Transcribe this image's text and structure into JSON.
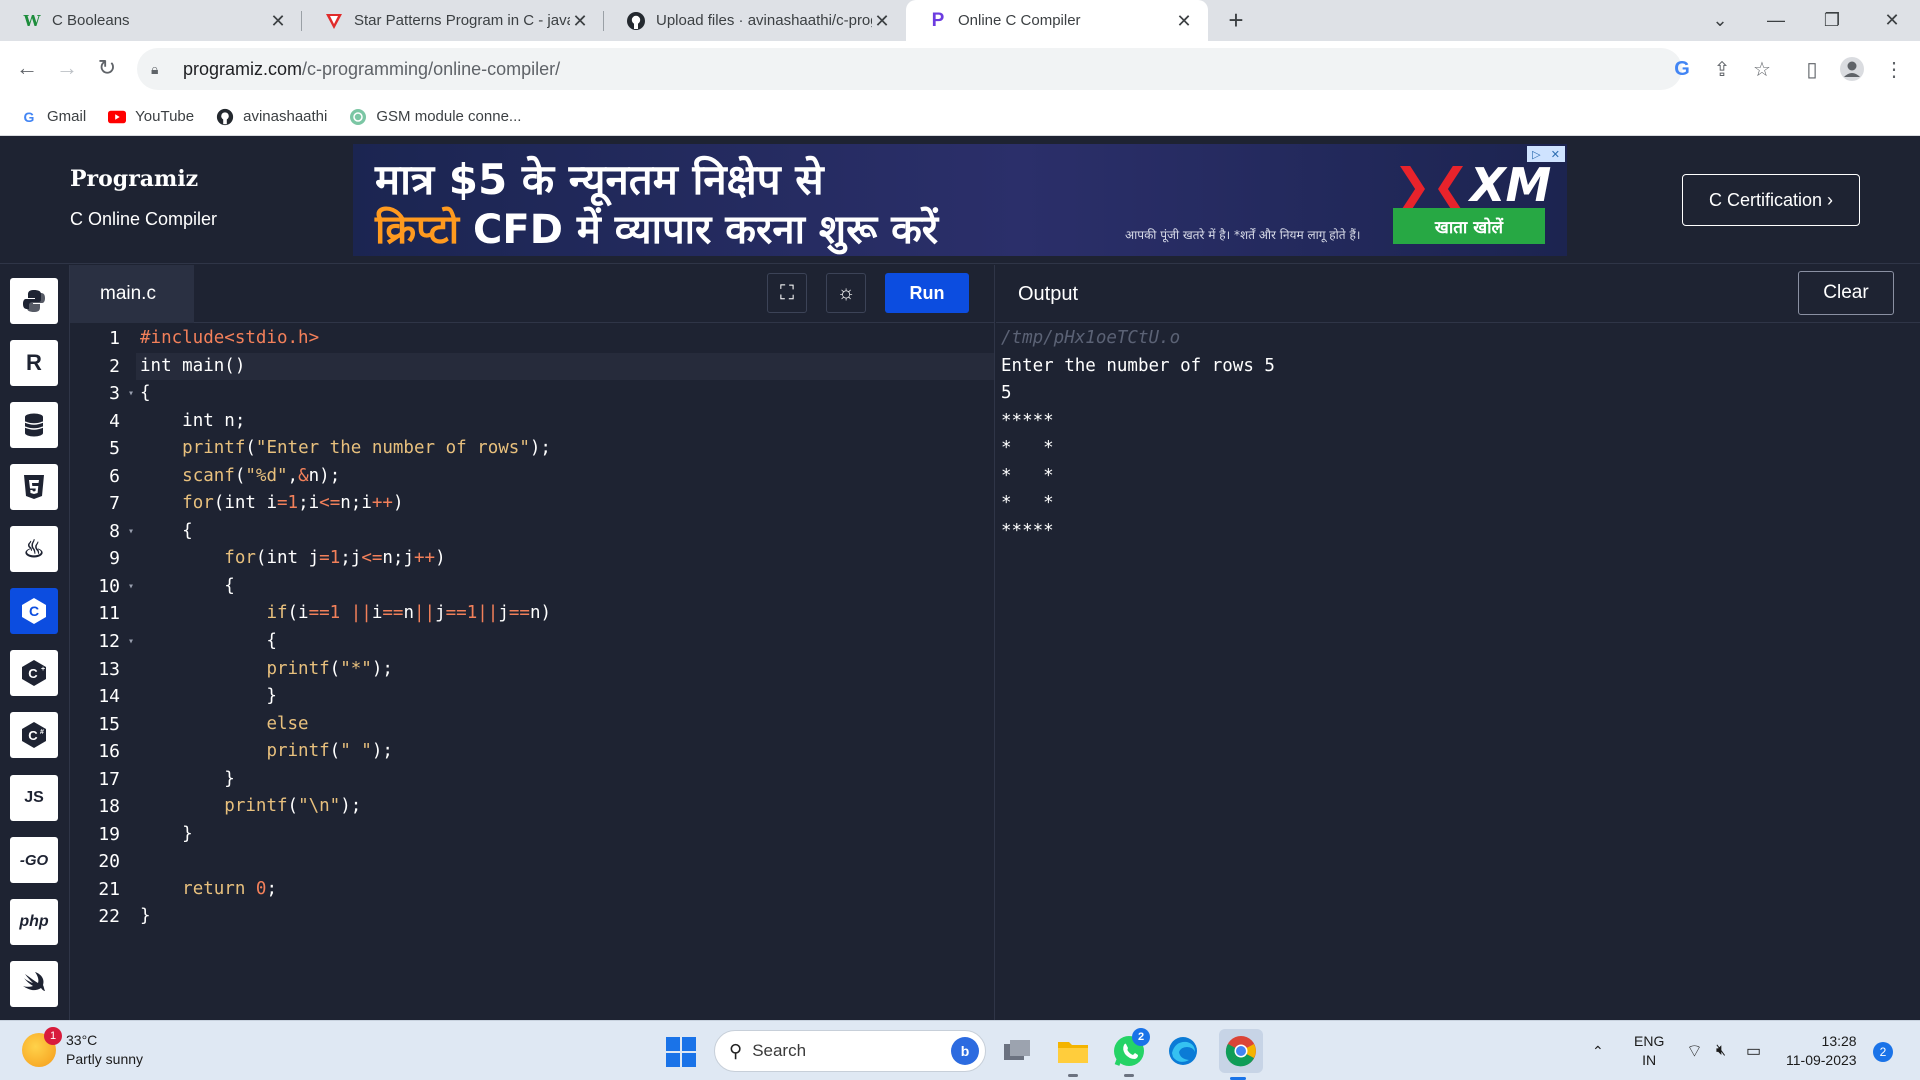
{
  "browser": {
    "tabs": [
      {
        "title": "C Booleans",
        "icon": "w-icon",
        "icon_color": "#1d8d3c"
      },
      {
        "title": "Star Patterns Program in C - javat",
        "icon": "javatpoint-icon",
        "icon_color": "#e02b2b"
      },
      {
        "title": "Upload files · avinashaathi/c-prog",
        "icon": "github-icon",
        "icon_color": "#24292f"
      },
      {
        "title": "Online C Compiler",
        "icon": "programiz-icon",
        "icon_color": "#6c3ce0"
      }
    ],
    "new_tab_label": "+",
    "url_host": "programiz.com",
    "url_path": "/c-programming/online-compiler/",
    "bookmarks": [
      {
        "label": "Gmail",
        "icon": "google-icon"
      },
      {
        "label": "YouTube",
        "icon": "youtube-icon"
      },
      {
        "label": "avinashaathi",
        "icon": "github-icon"
      },
      {
        "label": "GSM module conne...",
        "icon": "globe-icon"
      }
    ]
  },
  "site": {
    "logo": "Programiz",
    "subtitle": "C Online Compiler",
    "cert_button": "C Certification ›",
    "ad": {
      "line1": "मात्र $5 के न्यूनतम निक्षेप से",
      "line2_highlight": "क्रिप्टो",
      "line2_rest": " CFD में  व्यापार करना शुरू करें",
      "disclaimer": "आपकी पूंजी खतरे में है। *शर्तें और नियम लागू होते हैं।",
      "brand": "XM",
      "cta": "खाता खोलें"
    }
  },
  "rail": {
    "languages": [
      "python-icon",
      "r-icon",
      "sql-icon",
      "html5-icon",
      "java-icon",
      "c-icon",
      "cpp-icon",
      "csharp-icon",
      "js-icon",
      "go-icon",
      "php-icon",
      "swift-icon"
    ],
    "js_label": "JS",
    "go_label": "-GO",
    "php_label": "php",
    "active": "c-icon"
  },
  "editor": {
    "filename": "main.c",
    "run_label": "Run",
    "line_numbers": [
      "1",
      "2",
      "3",
      "4",
      "5",
      "6",
      "7",
      "8",
      "9",
      "10",
      "11",
      "12",
      "13",
      "14",
      "15",
      "16",
      "17",
      "18",
      "19",
      "20",
      "21",
      "22"
    ]
  },
  "output": {
    "title": "Output",
    "clear_label": "Clear",
    "lines": [
      "/tmp/pHx1oeTCtU.o",
      "Enter the number of rows 5",
      "5",
      "*****",
      "*   *",
      "*   *",
      "*   *",
      "*****"
    ]
  },
  "taskbar": {
    "weather_temp": "33°C",
    "weather_desc": "Partly sunny",
    "weather_badge": "1",
    "search_placeholder": "Search",
    "whatsapp_badge": "2",
    "lang_line1": "ENG",
    "lang_line2": "IN",
    "time": "13:28",
    "date": "11-09-2023",
    "notifications": "2"
  }
}
